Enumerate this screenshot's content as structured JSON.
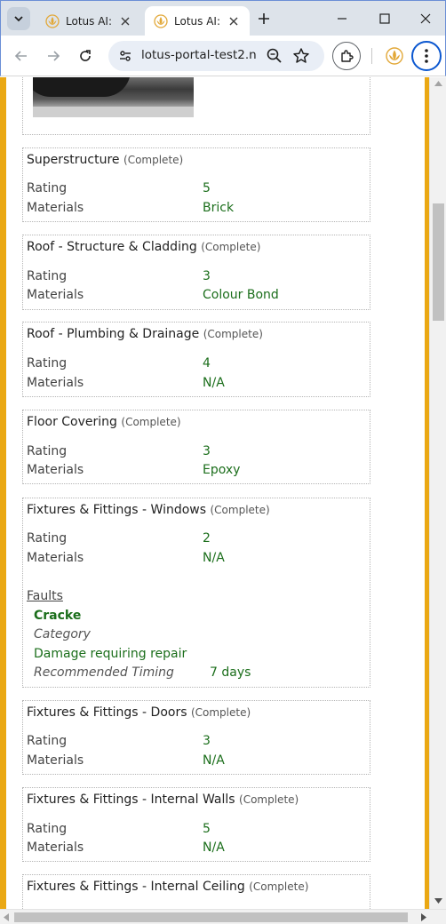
{
  "browser": {
    "tabs": [
      {
        "title": "Lotus AI:",
        "active": false
      },
      {
        "title": "Lotus AI:",
        "active": true
      }
    ],
    "url": "lotus-portal-test2.n...",
    "icons": [
      "tab-search-icon",
      "lotus-favicon",
      "close-icon",
      "new-tab-icon",
      "minimize-icon",
      "maximize-icon",
      "window-close-icon",
      "back-icon",
      "forward-icon",
      "reload-icon",
      "site-info-icon",
      "zoom-icon",
      "bookmark-star-icon",
      "extensions-icon",
      "lotus-extension-icon",
      "menu-kebab-icon"
    ]
  },
  "colors": {
    "frame_accent": "#eaa814",
    "value_green": "#1b6e1b",
    "focus_blue": "#0b57d0"
  },
  "report": {
    "rating_label": "Rating",
    "materials_label": "Materials",
    "faults_label": "Faults",
    "category_label": "Category",
    "timing_label": "Recommended Timing",
    "sections": [
      {
        "title": "Superstructure",
        "status": "(Complete)",
        "rating": "5",
        "materials": "Brick"
      },
      {
        "title": "Roof - Structure & Cladding",
        "status": "(Complete)",
        "rating": "3",
        "materials": "Colour Bond"
      },
      {
        "title": "Roof - Plumbing & Drainage",
        "status": "(Complete)",
        "rating": "4",
        "materials": "N/A"
      },
      {
        "title": "Floor Covering",
        "status": "(Complete)",
        "rating": "3",
        "materials": "Epoxy"
      },
      {
        "title": "Fixtures & Fittings - Windows",
        "status": "(Complete)",
        "rating": "2",
        "materials": "N/A",
        "fault": {
          "name": "Cracke",
          "category": "Damage requiring repair",
          "timing": "7 days"
        }
      },
      {
        "title": "Fixtures & Fittings - Doors",
        "status": "(Complete)",
        "rating": "3",
        "materials": "N/A"
      },
      {
        "title": "Fixtures & Fittings - Internal Walls",
        "status": "(Complete)",
        "rating": "5",
        "materials": "N/A"
      },
      {
        "title": "Fixtures & Fittings - Internal Ceiling",
        "status": "(Complete)"
      }
    ]
  }
}
